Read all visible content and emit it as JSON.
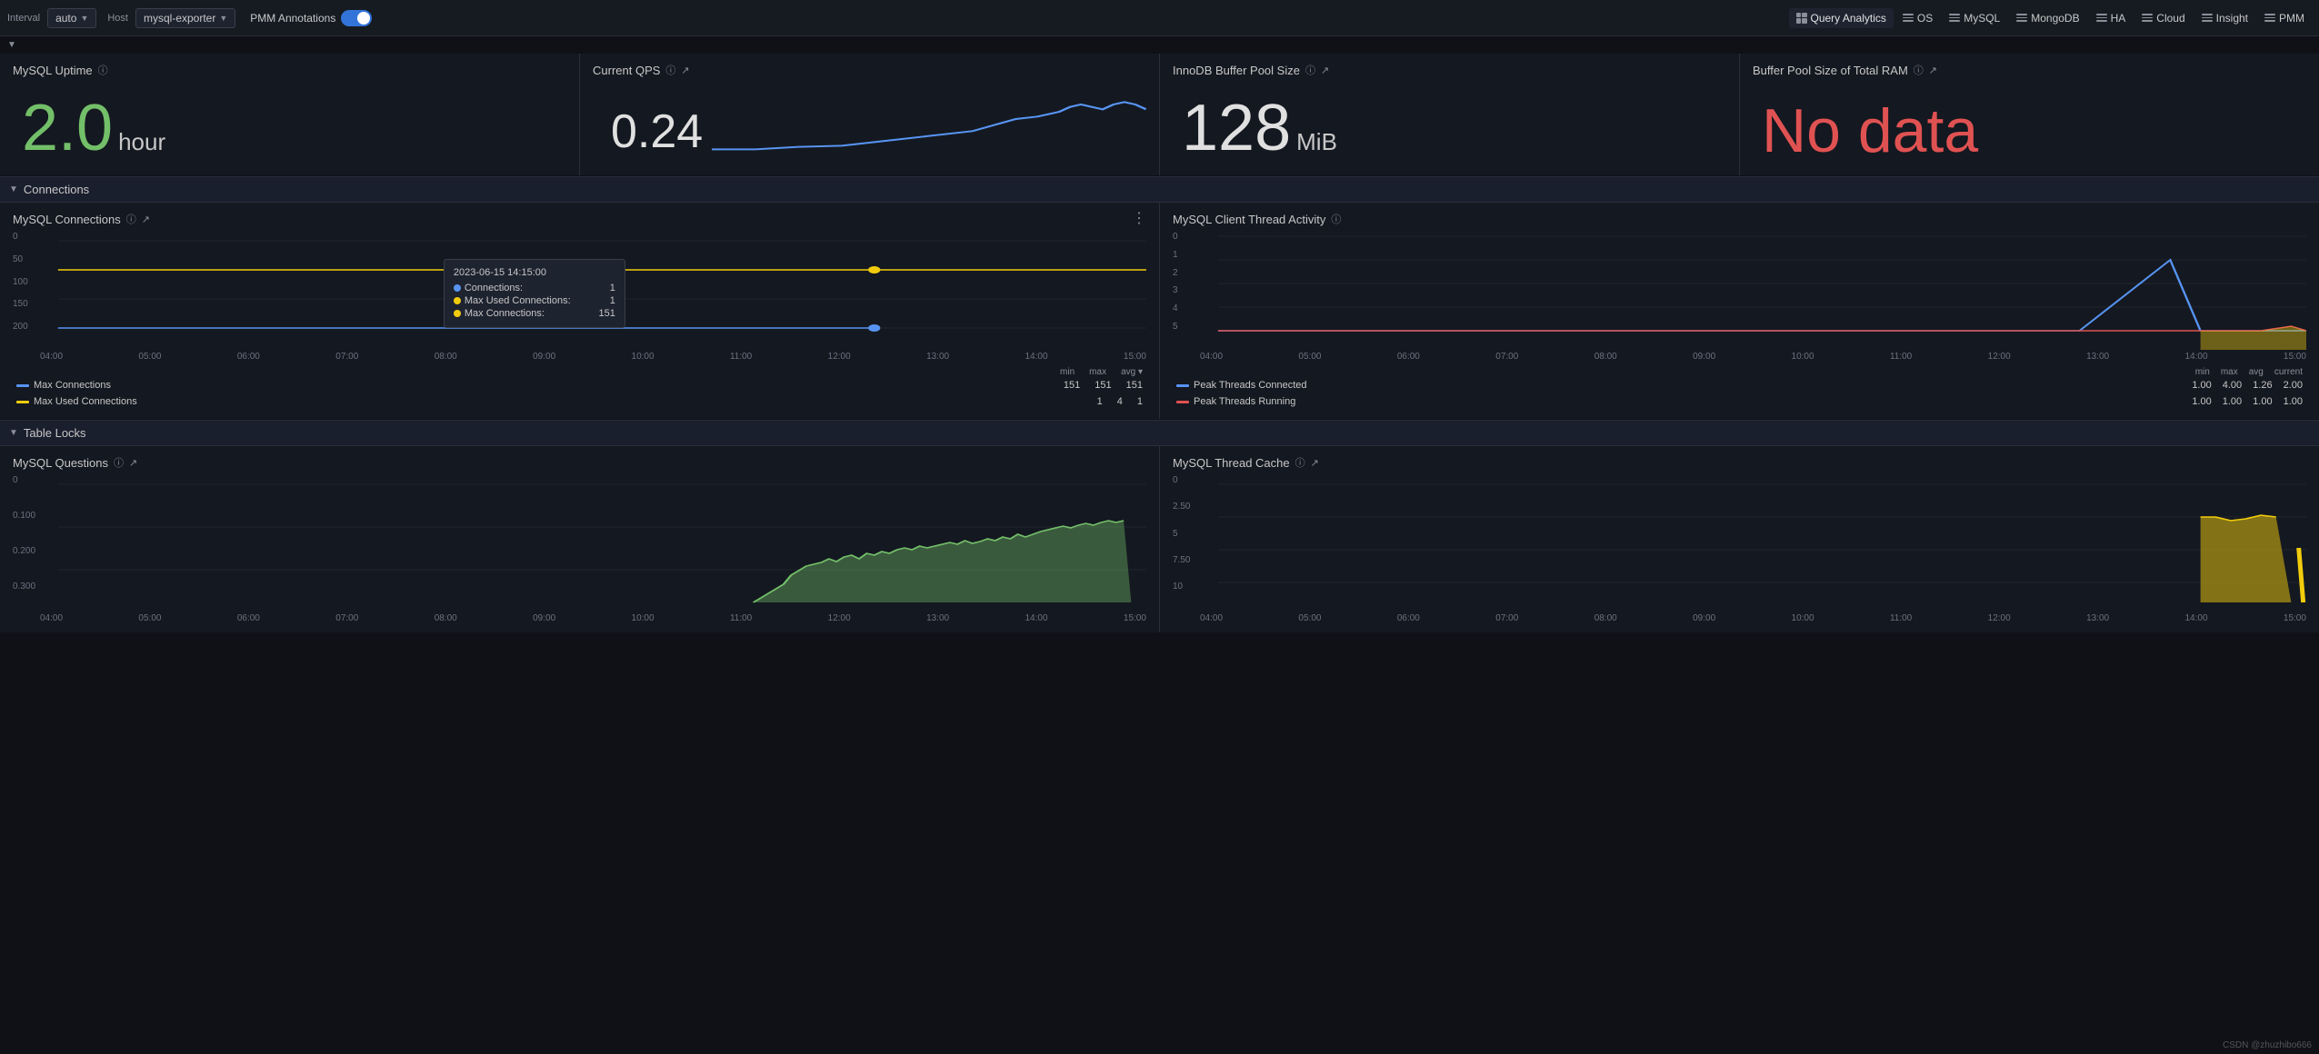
{
  "topnav": {
    "interval_label": "Interval",
    "interval_value": "auto",
    "host_label": "Host",
    "host_value": "mysql-exporter",
    "annotations_label": "PMM Annotations",
    "nav_right": [
      {
        "id": "query-analytics",
        "label": "Query Analytics",
        "icon": "grid"
      },
      {
        "id": "os",
        "label": "OS",
        "icon": "lines"
      },
      {
        "id": "mysql",
        "label": "MySQL",
        "icon": "lines"
      },
      {
        "id": "mongodb",
        "label": "MongoDB",
        "icon": "lines"
      },
      {
        "id": "ha",
        "label": "HA",
        "icon": "lines"
      },
      {
        "id": "cloud",
        "label": "Cloud",
        "icon": "lines"
      },
      {
        "id": "insight",
        "label": "Insight",
        "icon": "lines"
      },
      {
        "id": "pmm",
        "label": "PMM",
        "icon": "lines"
      }
    ]
  },
  "cards": {
    "uptime": {
      "title": "MySQL Uptime",
      "value": "2.0",
      "unit": "hour",
      "color": "green"
    },
    "qps": {
      "title": "Current QPS",
      "value": "0.24"
    },
    "buffer_pool": {
      "title": "InnoDB Buffer Pool Size",
      "value": "128",
      "unit": "MiB"
    },
    "buffer_total": {
      "title": "Buffer Pool Size of Total RAM",
      "value": "No data"
    }
  },
  "sections": {
    "connections": "Connections",
    "table_locks": "Table Locks"
  },
  "mysql_connections": {
    "title": "MySQL Connections",
    "tooltip_date": "2023-06-15 14:15:00",
    "tooltip_rows": [
      {
        "label": "Connections:",
        "value": "1",
        "color": "#5794f2"
      },
      {
        "label": "Max Used Connections:",
        "value": "1",
        "color": "#f2cc0c"
      },
      {
        "label": "Max Connections:",
        "value": "151",
        "color": "#f2cc0c"
      }
    ],
    "y_labels": [
      "0",
      "50",
      "100",
      "150",
      "200"
    ],
    "x_labels": [
      "04:00",
      "05:00",
      "06:00",
      "07:00",
      "08:00",
      "09:00",
      "10:00",
      "11:00",
      "12:00",
      "13:00",
      "14:00",
      "15:00"
    ],
    "legend_cols": [
      "min",
      "max",
      "avg ▾"
    ],
    "legend_rows": [
      {
        "label": "Max Connections",
        "color": "#5794f2",
        "min": "151",
        "max": "151",
        "avg": "151"
      },
      {
        "label": "Max Used Connections",
        "color": "#f2cc0c",
        "min": "1",
        "max": "4",
        "avg": "1"
      }
    ]
  },
  "mysql_client_threads": {
    "title": "MySQL Client Thread Activity",
    "y_labels": [
      "0",
      "1",
      "2",
      "3",
      "4",
      "5"
    ],
    "x_labels": [
      "04:00",
      "05:00",
      "06:00",
      "07:00",
      "08:00",
      "09:00",
      "10:00",
      "11:00",
      "12:00",
      "13:00",
      "14:00",
      "15:00"
    ],
    "legend_cols": [
      "min",
      "max",
      "avg",
      "current"
    ],
    "legend_rows": [
      {
        "label": "Peak Threads Connected",
        "color": "#5794f2",
        "min": "1.00",
        "max": "4.00",
        "avg": "1.26",
        "current": "2.00"
      },
      {
        "label": "Peak Threads Running",
        "color": "#e05252",
        "min": "1.00",
        "max": "1.00",
        "avg": "1.00",
        "current": "1.00"
      }
    ]
  },
  "mysql_questions": {
    "title": "MySQL Questions",
    "y_labels": [
      "0",
      "0.100",
      "0.200",
      "0.300"
    ],
    "x_labels": [
      "04:00",
      "05:00",
      "06:00",
      "07:00",
      "08:00",
      "09:00",
      "10:00",
      "11:00",
      "12:00",
      "13:00",
      "14:00",
      "15:00"
    ]
  },
  "mysql_thread_cache": {
    "title": "MySQL Thread Cache",
    "y_labels": [
      "0",
      "2.50",
      "5",
      "7.50",
      "10"
    ],
    "x_labels": [
      "04:00",
      "05:00",
      "06:00",
      "07:00",
      "08:00",
      "09:00",
      "10:00",
      "11:00",
      "12:00",
      "13:00",
      "14:00",
      "15:00"
    ]
  },
  "watermark": "CSDN @zhuzhibo666"
}
